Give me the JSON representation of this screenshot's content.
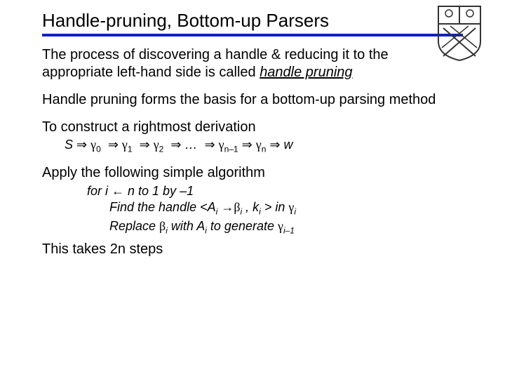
{
  "title": "Handle-pruning, Bottom-up Parsers",
  "p1a": "The process of discovering a handle & reducing it to the appropriate left-hand side is called ",
  "p1b": "handle pruning",
  "p2": "Handle pruning forms the basis for a bottom-up parsing method",
  "p3": "To construct a rightmost derivation",
  "deriv": {
    "S": "S",
    "imp": "⇒",
    "g": "γ",
    "dots": "…",
    "w": "w"
  },
  "p4": "Apply the following simple algorithm",
  "algo": {
    "l1a": "for i ",
    "l1arrow": "←",
    "l1b": " n to 1 by –1",
    "l2a": "Find the handle <A",
    "l2arrow": "→",
    "l2b": " , k",
    "l2c": " > in ",
    "l3a": "Replace ",
    "l3b": " with A",
    "l3c": " to generate ",
    "beta": "β",
    "gamma": "γ"
  },
  "p5": "This takes 2n steps"
}
